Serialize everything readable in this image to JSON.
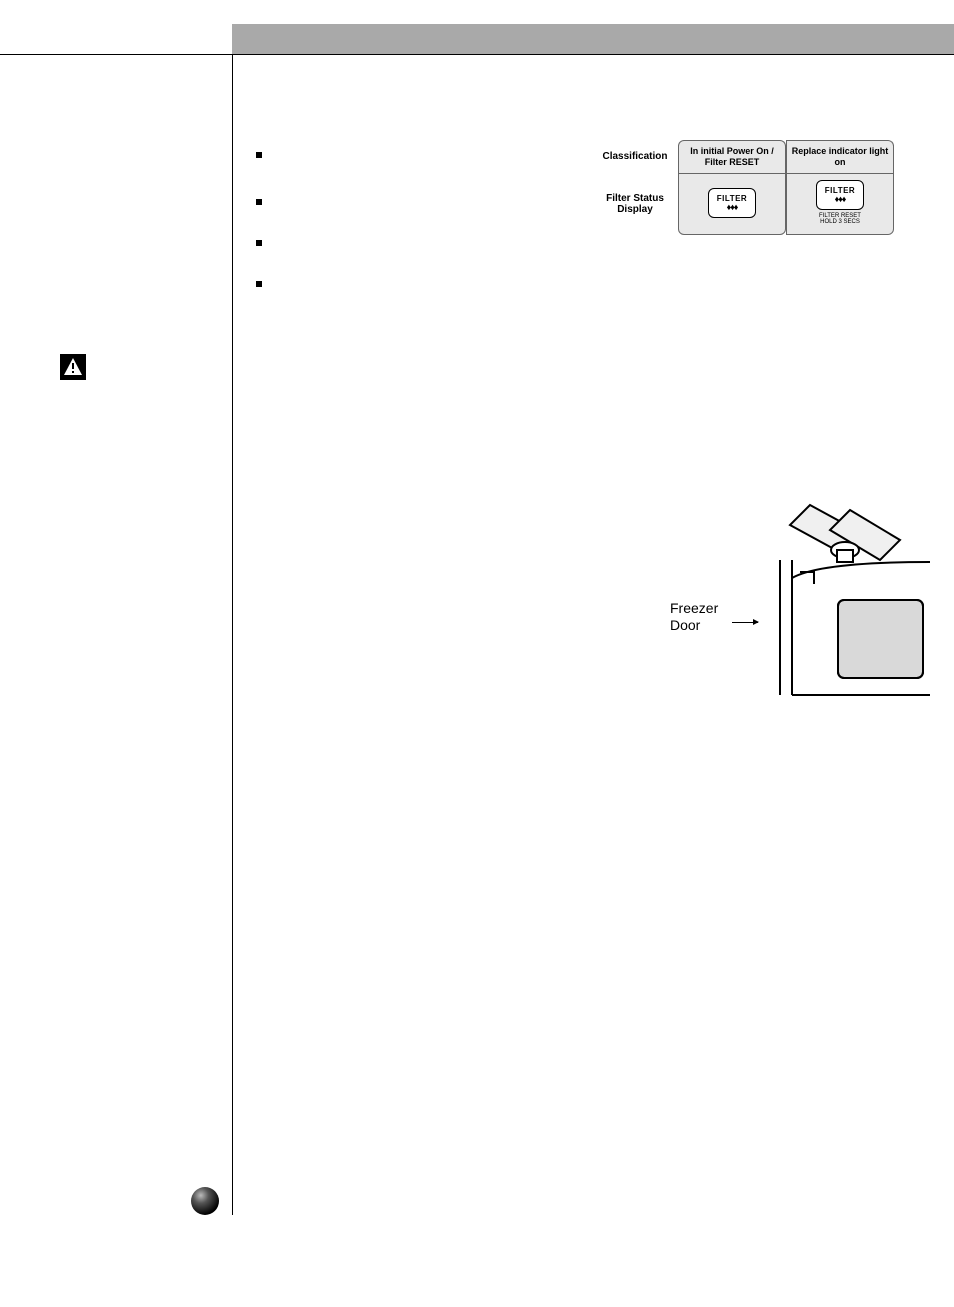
{
  "table": {
    "row1_label": "Classification",
    "row1_col1": "In initial Power On / Filter RESET",
    "row1_col2": "Replace indicator light on",
    "row2_label_line1": "Filter Status",
    "row2_label_line2": "Display",
    "badge_word": "FILTER",
    "badge_drops": "♦♦♦",
    "caption_line1": "FILTER RESET",
    "caption_line2": "HOLD 3 SECS"
  },
  "illustration": {
    "label_line1": "Freezer",
    "label_line2": "Door"
  }
}
